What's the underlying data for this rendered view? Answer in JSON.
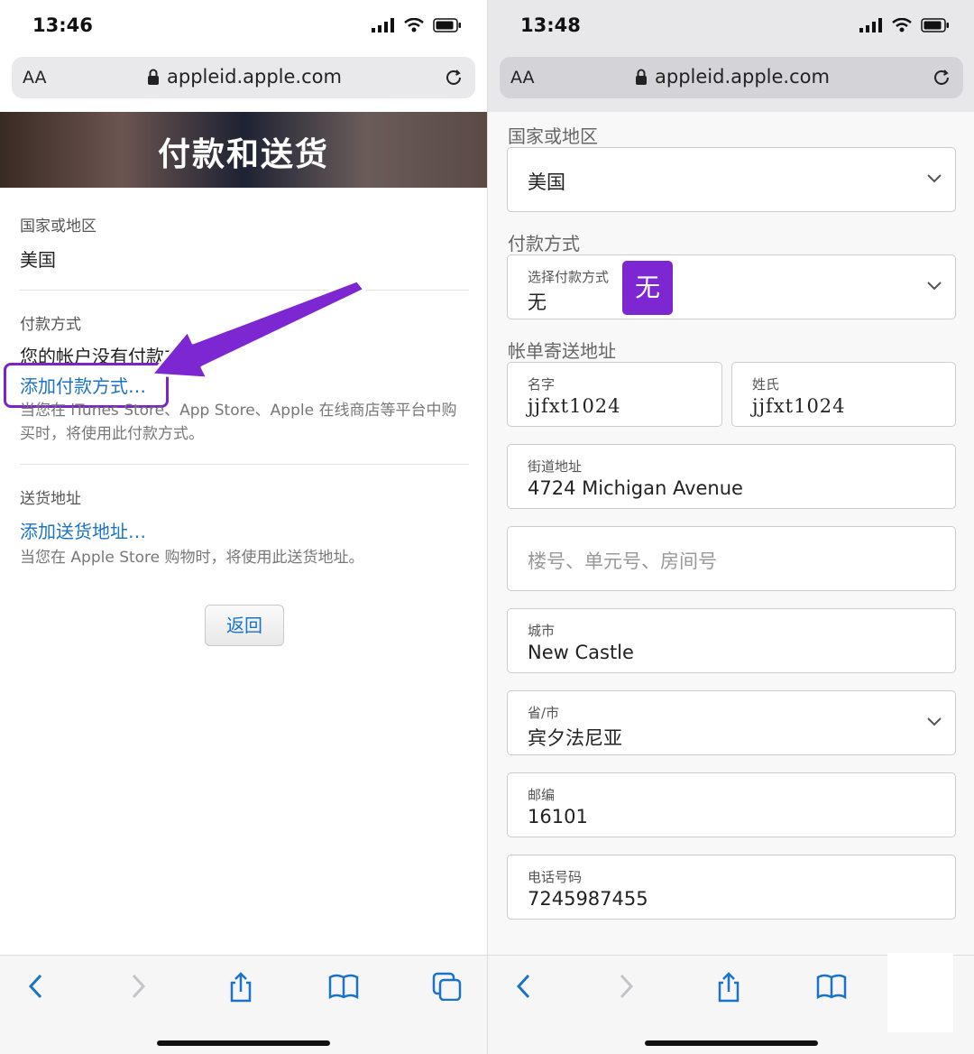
{
  "left": {
    "status": {
      "time": "13:46"
    },
    "url": {
      "aa": "AA",
      "domain": "appleid.apple.com"
    },
    "banner_title": "付款和送货",
    "country": {
      "label": "国家或地区",
      "value": "美国"
    },
    "payment": {
      "label": "付款方式",
      "no_method_text": "您的帐户没有付款方式。",
      "add_link": "添加付款方式…",
      "note": "当您在 iTunes Store、App Store、Apple 在线商店等平台中购买时，将使用此付款方式。"
    },
    "shipping": {
      "label": "送货地址",
      "add_link": "添加送货地址…",
      "note": "当您在 Apple Store 购物时，将使用此送货地址。"
    },
    "back_button": "返回",
    "annotation_color": "#7d27d3"
  },
  "right": {
    "status": {
      "time": "13:48"
    },
    "url": {
      "aa": "AA",
      "domain": "appleid.apple.com"
    },
    "country": {
      "label": "国家或地区",
      "value": "美国"
    },
    "payment": {
      "label": "付款方式",
      "select_label": "选择付款方式",
      "value": "无",
      "badge": "无"
    },
    "billing": {
      "label": "帐单寄送地址",
      "first_name": {
        "label": "名字",
        "value": "jjfxt1024"
      },
      "last_name": {
        "label": "姓氏",
        "value": "jjfxt1024"
      },
      "street": {
        "label": "街道地址",
        "value": "4724 Michigan Avenue"
      },
      "unit_placeholder": "楼号、单元号、房间号",
      "city": {
        "label": "城市",
        "value": "New Castle"
      },
      "state": {
        "label": "省/市",
        "value": "宾夕法尼亚"
      },
      "zip": {
        "label": "邮编",
        "value": "16101"
      },
      "phone": {
        "label": "电话号码",
        "value": "7245987455"
      }
    }
  },
  "colors": {
    "link": "#1a73c6",
    "accent": "#7d27d3"
  }
}
